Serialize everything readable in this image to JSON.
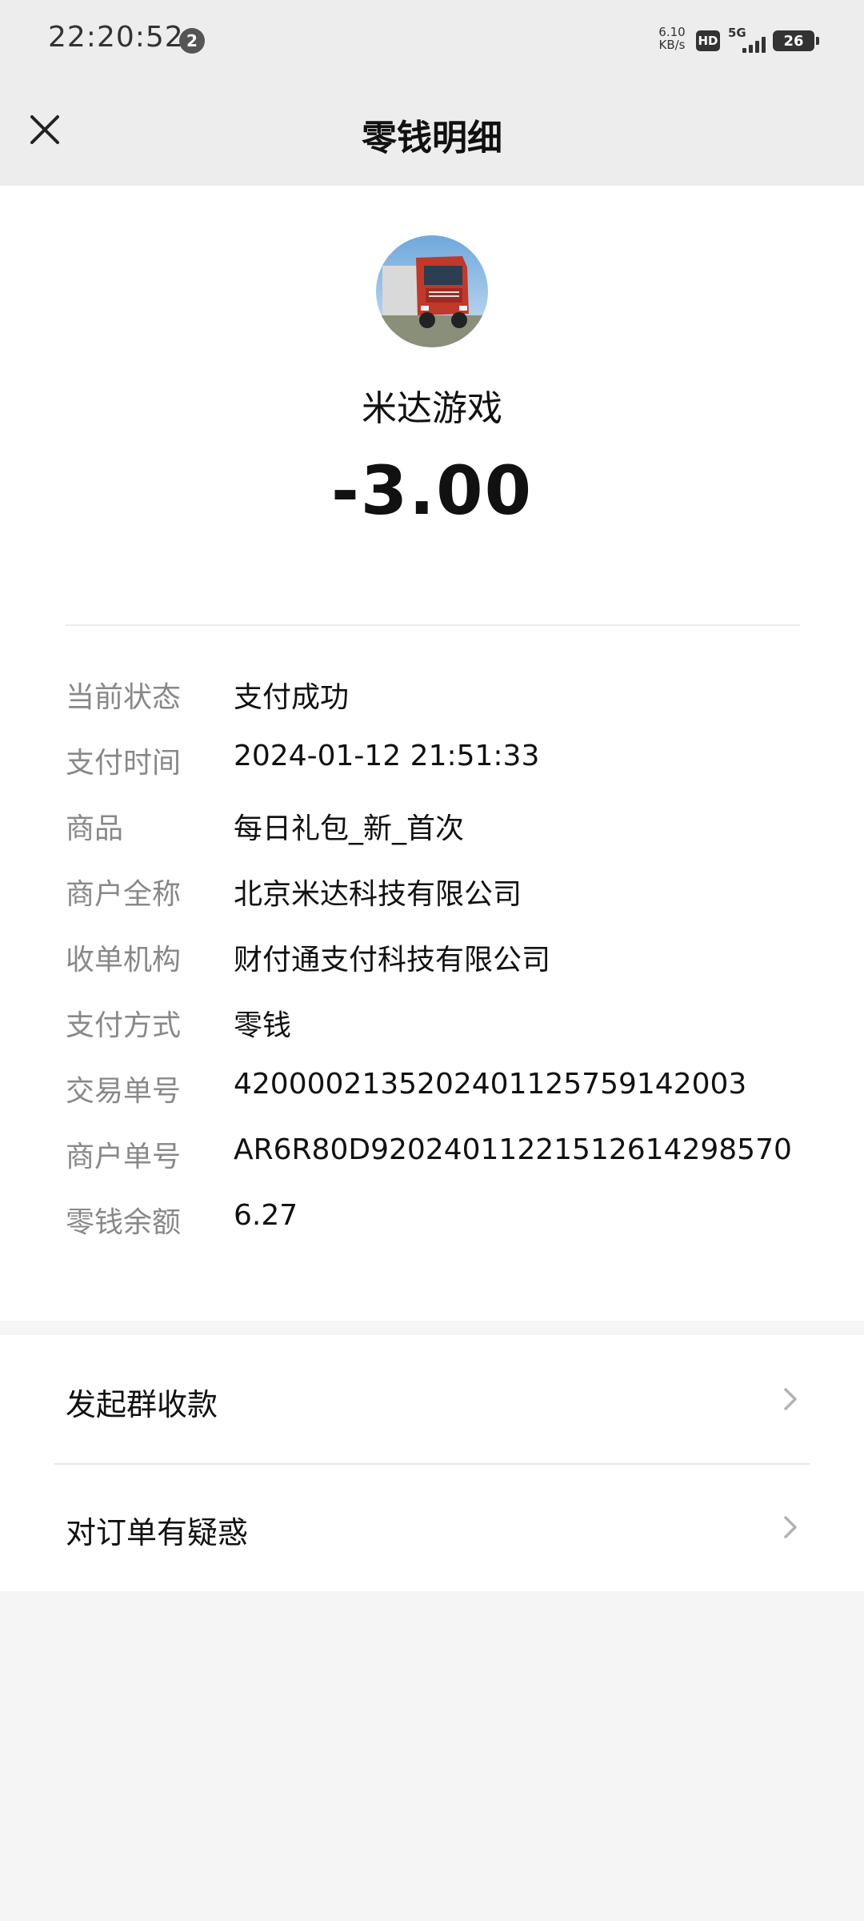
{
  "status_bar": {
    "time": "22:20:52",
    "notification_count": "2",
    "net_speed_value": "6.10",
    "net_speed_unit": "KB/s",
    "hd_label": "HD",
    "network_label": "5G",
    "battery_level": "26"
  },
  "header": {
    "title": "零钱明细",
    "close_icon": "close-icon"
  },
  "merchant": {
    "avatar_icon": "truck-avatar",
    "name": "米达游戏",
    "amount": "-3.00"
  },
  "details": [
    {
      "label": "当前状态",
      "value": "支付成功"
    },
    {
      "label": "支付时间",
      "value": "2024-01-12 21:51:33"
    },
    {
      "label": "商品",
      "value": "每日礼包_新_首次"
    },
    {
      "label": "商户全称",
      "value": "北京米达科技有限公司"
    },
    {
      "label": "收单机构",
      "value": "财付通支付科技有限公司"
    },
    {
      "label": "支付方式",
      "value": "零钱"
    },
    {
      "label": "交易单号",
      "value": "4200002135202401125759142003"
    },
    {
      "label": "商户单号",
      "value": "AR6R80D920240112215126142985​70"
    },
    {
      "label": "零钱余额",
      "value": "6.27"
    }
  ],
  "actions": [
    {
      "label": "发起群收款",
      "icon": "chevron-right-icon"
    },
    {
      "label": "对订单有疑惑",
      "icon": "chevron-right-icon"
    }
  ],
  "colors": {
    "header_bg": "#ededed",
    "page_bg": "#f5f5f5",
    "label_gray": "#888888",
    "text": "#111111"
  }
}
